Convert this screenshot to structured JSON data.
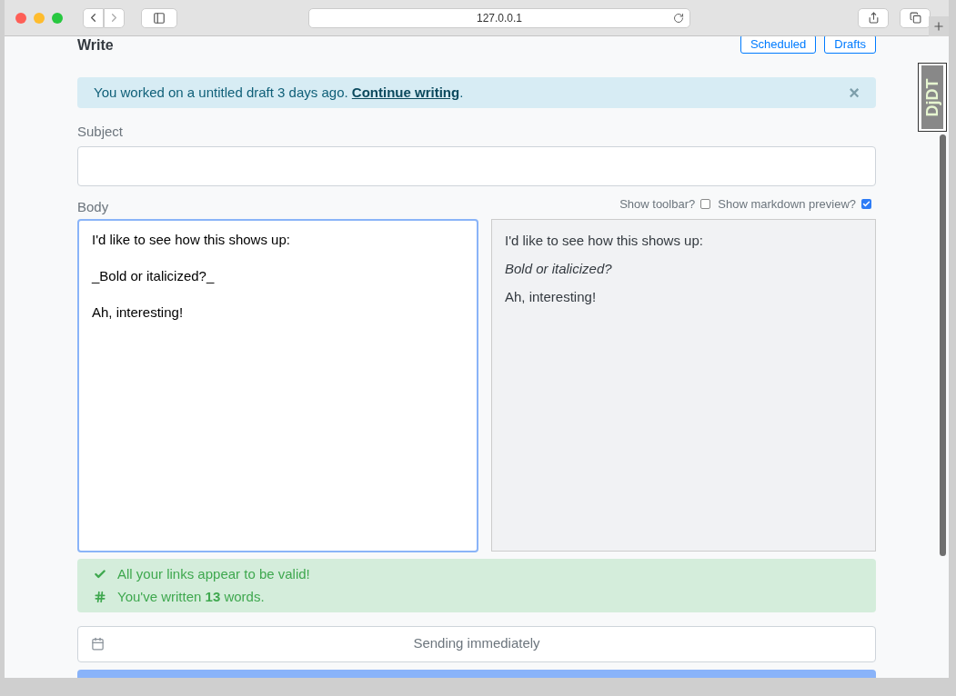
{
  "browser": {
    "address": "127.0.0.1"
  },
  "page": {
    "title": "Write",
    "header_buttons": [
      "Scheduled",
      "Drafts"
    ],
    "alert": {
      "text": "You worked on a untitled draft 3 days ago.",
      "link": "Continue writing",
      "after": ".",
      "close": "×"
    },
    "subject": {
      "label": "Subject"
    },
    "body": {
      "label": "Body",
      "options": [
        {
          "label": "Show toolbar?",
          "checked": false
        },
        {
          "label": "Show markdown preview?",
          "checked": true
        }
      ],
      "source_paragraphs": [
        "I'd like to see how this shows up:",
        "_Bold or italicized?_",
        "Ah, interesting!"
      ],
      "preview": [
        {
          "kind": "plain",
          "text": "I'd like to see how this shows up:"
        },
        {
          "kind": "italic",
          "text": "Bold or italicized?"
        },
        {
          "kind": "plain",
          "text": "Ah, interesting!"
        }
      ]
    },
    "checks": [
      {
        "kind": "check",
        "text": "All your links appear to be valid!"
      },
      {
        "kind": "hash",
        "text": "You've written **13** words."
      }
    ],
    "schedule": "Sending immediately"
  },
  "debug_toolbar": {
    "handle": "DjDT"
  }
}
